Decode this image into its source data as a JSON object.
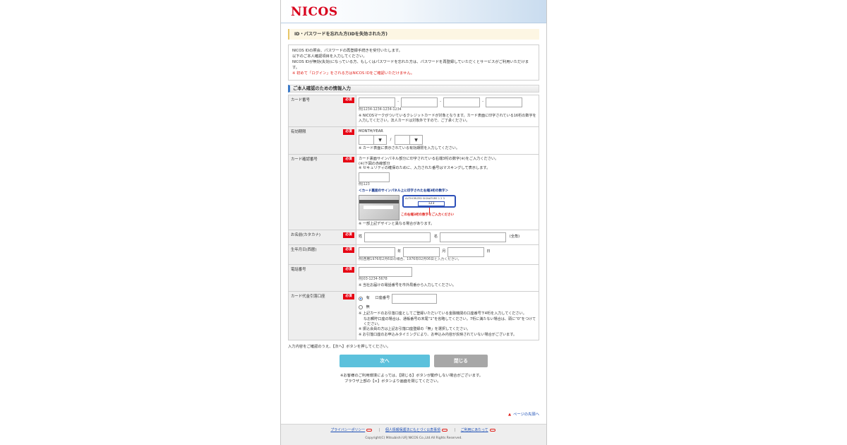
{
  "brand": {
    "logo_main": "NICOS"
  },
  "title": "ID・パスワードを忘れた方(IDを失効された方)",
  "notice": {
    "lines": [
      "NICOS IDの照会、パスワードの再登録手続きを受付いたします。",
      "以下のご本人確認項目を入力してください。",
      "NICOS IDが無効(失効)になっている方、もしくはパスワードを忘れた方は、パスワードを再登録していただくとサービスがご利用いただけます。"
    ],
    "warning": "※ 初めて「ログイン」をされる方はNICOS IDをご確認いただけません。"
  },
  "section_title": "ご本人確認のための情報入力",
  "required_label": "必須",
  "card_number": {
    "label": "カード番号",
    "sep": "-",
    "example": "例)1234-1234-1234-1234",
    "note": "※ NICOSマークがついているクレジットカードが対象となります。カード表面に印字されている16桁の数字を入力してください。法人カードは対象外ですので、ご了承ください。"
  },
  "expiry": {
    "label": "有効期限",
    "format": "MONTH/YEAR",
    "slash": "/",
    "arrow": "▼",
    "note": "※ カード表面に表示されている有効期限を入力してください。"
  },
  "security_code": {
    "label": "カード確認番号",
    "line1": "カード裏面サインパネル部分に印字されている右端3桁の数字(※)をご入力ください。",
    "line2": "(※)下図の赤線部分",
    "line3": "※ セキュリティの確保のために、入力された番号はマスキングして表示します。",
    "example": "例)123",
    "figure_caption_top": "＜カード裏面のサインパネル上に印字された右端3桁の数字＞",
    "figure_panel_text": "AUTHORIZED SIGNATURE 1 2 3",
    "figure_value": "123",
    "figure_caption_bottom": "この右端3桁の数字をご入力ください",
    "note": "※ 一部上記デザインと異なる場合があります。"
  },
  "name": {
    "label": "お名前(カタカナ)",
    "sei": "姓",
    "mei": "名",
    "suffix": "(全角)"
  },
  "birthdate": {
    "label": "生年月日(西暦)",
    "year_suffix": "年",
    "month_suffix": "月",
    "day_suffix": "日",
    "example": "例)西暦1976年2月6日の場合、1976年02月06日と入力ください。"
  },
  "phone": {
    "label": "電話番号",
    "example": "例)03-1234-5678",
    "note": "※ 当社お届けの電話番号を市外局番から入力してください。"
  },
  "account": {
    "label": "カード代金引落口座",
    "yes": "有",
    "account_number": "口座番号",
    "no": "無",
    "notes": [
      "※ 上記カードのお引落口座としてご登録いただいている金融機関の口座番号下4桁を入力してください。",
      "なお郵貯口座の場合は、通帳番号の末尾“1”を省略してください。7桁に満たない場合は、頭に“0”をつけてください。",
      "※ 振込会員の方は上記お引落口座登録の「無」を選択してください。",
      "※ お引落口座のお申込みタイミングにより、お申込み内容が反映されていない場合がございます。"
    ]
  },
  "confirm_text": "入力内容をご確認のうえ、【次へ】ボタンを押してください。",
  "buttons": {
    "next": "次へ",
    "close": "閉じる"
  },
  "button_notes": [
    "※お客様のご利用環境によっては、【閉じる】ボタンが動作しない場合がございます。",
    "ブラウザ上部の【×】ボタンより画面を閉じてください。"
  ],
  "page_top": "ページの先頭へ",
  "footer": {
    "links": [
      "プライバシーポリシー",
      "個人情報保護法にもとづく公表事項",
      "ご利用にあたって"
    ],
    "copyright": "Copyright(C) Mitsubishi UFJ NICOS Co.,Ltd.All Rights Reserved."
  }
}
